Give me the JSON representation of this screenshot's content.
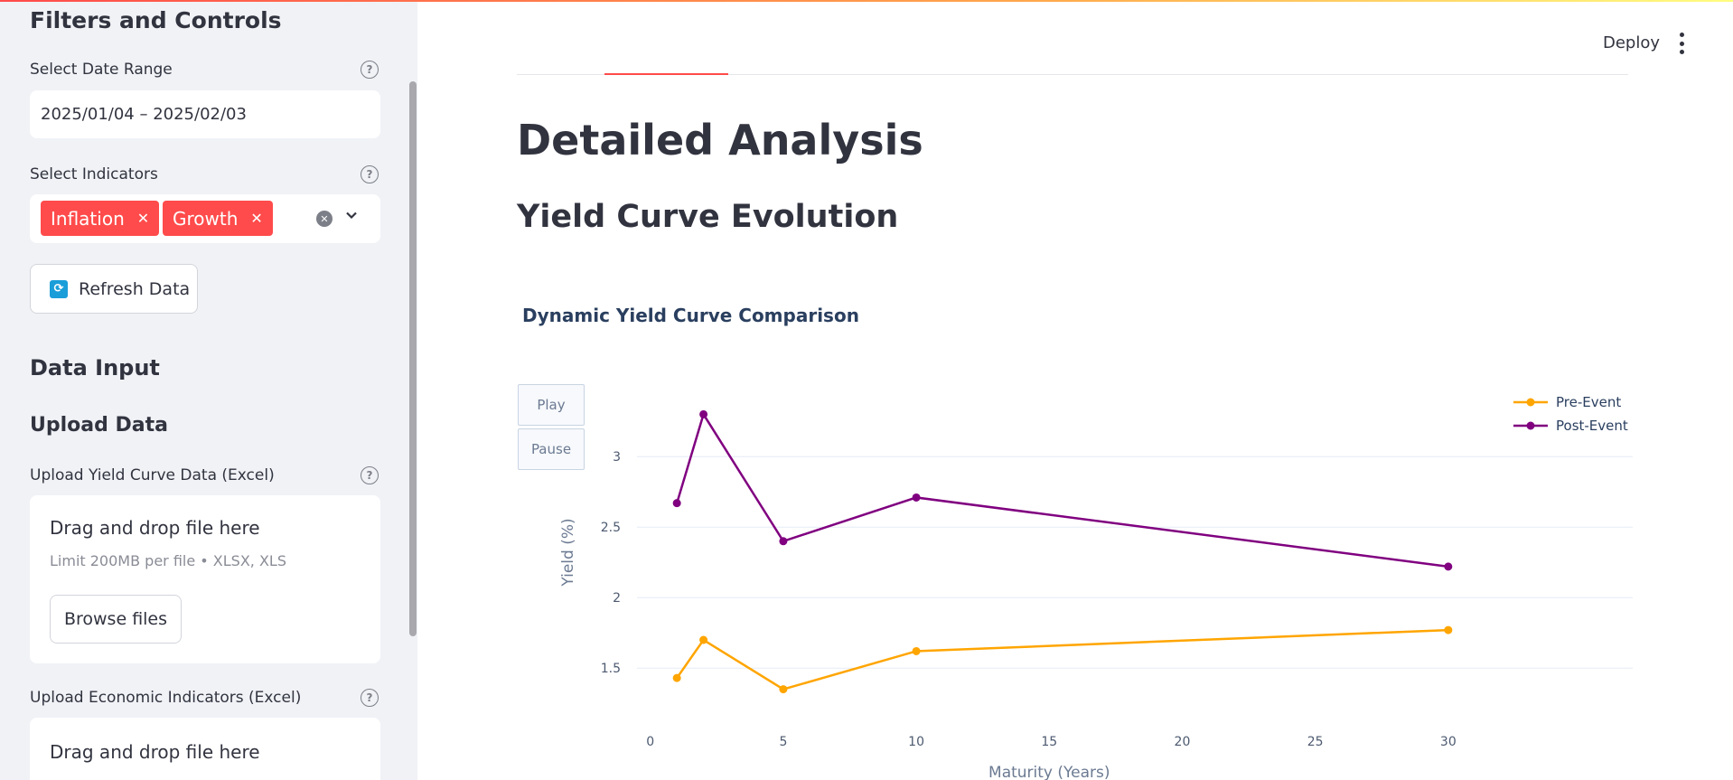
{
  "sidebar": {
    "title": "Filters and Controls",
    "date_range": {
      "label": "Select Date Range",
      "value": "2025/01/04 – 2025/02/03"
    },
    "indicators": {
      "label": "Select Indicators",
      "chips": [
        "Inflation",
        "Growth"
      ]
    },
    "refresh_label": "Refresh Data",
    "data_input_title": "Data Input",
    "upload_title": "Upload Data",
    "upload_yield": {
      "label": "Upload Yield Curve Data (Excel)",
      "drop_title": "Drag and drop file here",
      "drop_sub": "Limit 200MB per file • XLSX, XLS",
      "browse_label": "Browse files"
    },
    "upload_econ": {
      "label": "Upload Economic Indicators (Excel)",
      "drop_title": "Drag and drop file here"
    }
  },
  "header": {
    "deploy_label": "Deploy"
  },
  "main": {
    "title": "Detailed Analysis",
    "section_title": "Yield Curve Evolution"
  },
  "chart_data": {
    "type": "line",
    "title": "Dynamic Yield Curve Comparison",
    "xlabel": "Maturity (Years)",
    "ylabel": "Yield (%)",
    "xlim": [
      -0.5,
      31.5
    ],
    "ylim": [
      1.2,
      3.45
    ],
    "xticks": [
      0,
      5,
      10,
      15,
      20,
      25,
      30
    ],
    "yticks": [
      1.5,
      2,
      2.5,
      3
    ],
    "grid": true,
    "legend_position": "top-right",
    "controls": [
      "Play",
      "Pause"
    ],
    "series": [
      {
        "name": "Pre-Event",
        "color": "#ffa500",
        "x": [
          1,
          2,
          5,
          10,
          30
        ],
        "y": [
          1.43,
          1.7,
          1.35,
          1.62,
          1.77
        ]
      },
      {
        "name": "Post-Event",
        "color": "#800080",
        "x": [
          1,
          2,
          5,
          10,
          30
        ],
        "y": [
          2.67,
          3.3,
          2.4,
          2.71,
          2.22
        ]
      }
    ]
  }
}
